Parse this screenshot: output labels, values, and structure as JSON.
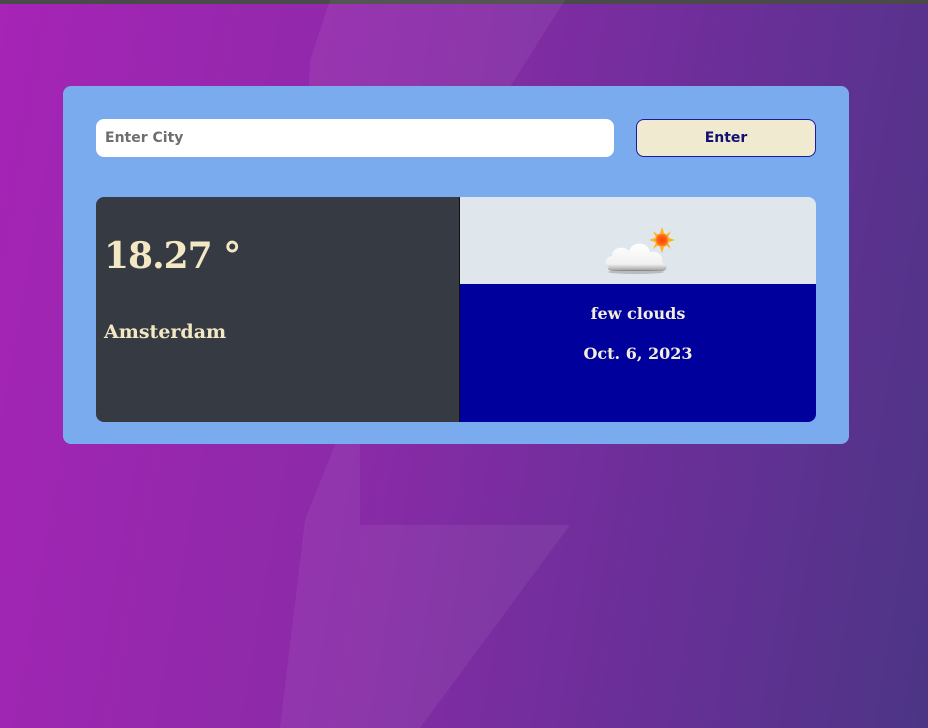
{
  "search": {
    "placeholder": "Enter City",
    "value": "",
    "button_label": "Enter"
  },
  "weather": {
    "temperature": "18.27 °",
    "city": "Amsterdam",
    "description": "few clouds",
    "date": "Oct. 6, 2023",
    "icon": "few-clouds-icon"
  },
  "colors": {
    "panel": "#79abee",
    "card_left": "#363b43",
    "card_info": "#00009c",
    "card_icon_bg": "#dfe6ec",
    "button_bg": "#f0ead1",
    "accent_text": "#f3e8c3"
  }
}
